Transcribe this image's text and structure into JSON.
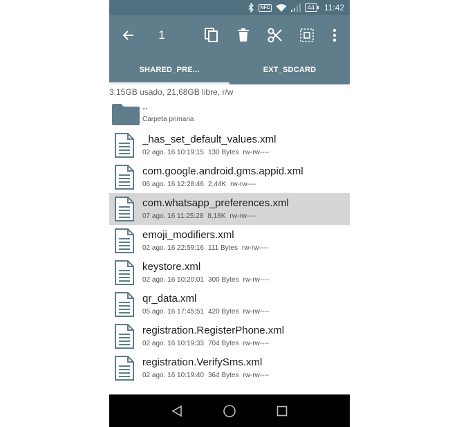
{
  "status_bar": {
    "battery": "44",
    "time": "11:42",
    "nfc": "NFC"
  },
  "toolbar": {
    "selection_count": "1",
    "icons": [
      "back-arrow-icon",
      "copy-icon",
      "delete-icon",
      "cut-icon",
      "select-all-icon",
      "more-vert-icon"
    ]
  },
  "tabs": [
    {
      "label": "SHARED_PRE...",
      "active": true
    },
    {
      "label": "EXT_SDCARD",
      "active": false
    }
  ],
  "storage": {
    "info": "3,15GB usado, 21,68GB libre, r/w"
  },
  "parent": {
    "name": "..",
    "subtitle": "Carpeta primaria"
  },
  "files": [
    {
      "name": "_has_set_default_values.xml",
      "date": "02 ago. 16 10:19:15",
      "size": "130 Bytes",
      "perms": "rw-rw----",
      "selected": false
    },
    {
      "name": "com.google.android.gms.appid.xml",
      "date": "06 ago. 16 12:28:46",
      "size": "2,44K",
      "perms": "rw-rw----",
      "selected": false
    },
    {
      "name": "com.whatsapp_preferences.xml",
      "date": "07 ago. 16 11:25:28",
      "size": "8,18K",
      "perms": "rw-rw----",
      "selected": true
    },
    {
      "name": "emoji_modifiers.xml",
      "date": "02 ago. 16 22:59:16",
      "size": "111 Bytes",
      "perms": "rw-rw----",
      "selected": false
    },
    {
      "name": "keystore.xml",
      "date": "02 ago. 16 10:20:01",
      "size": "300 Bytes",
      "perms": "rw-rw----",
      "selected": false
    },
    {
      "name": "qr_data.xml",
      "date": "05 ago. 16 17:45:51",
      "size": "420 Bytes",
      "perms": "rw-rw----",
      "selected": false
    },
    {
      "name": "registration.RegisterPhone.xml",
      "date": "02 ago. 16 10:19:33",
      "size": "704 Bytes",
      "perms": "rw-rw----",
      "selected": false
    },
    {
      "name": "registration.VerifySms.xml",
      "date": "02 ago. 16 10:19:40",
      "size": "364 Bytes",
      "perms": "rw-rw----",
      "selected": false
    }
  ],
  "colors": {
    "toolbar": "#607d8b",
    "status_bar": "#51707f",
    "selected_row": "#d6d6d6",
    "icon": "#607d8b"
  }
}
